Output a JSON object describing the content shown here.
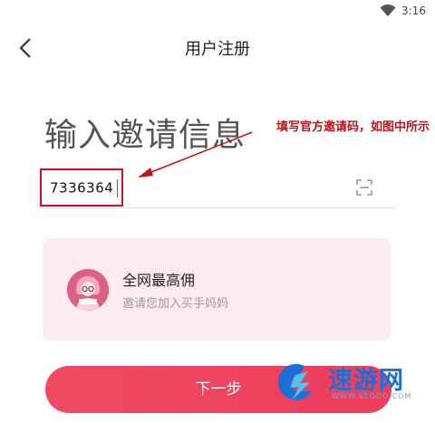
{
  "status_bar": {
    "time": "3:16",
    "wifi_icon": "wifi-icon"
  },
  "header": {
    "title": "用户注册",
    "back_icon": "chevron-left-icon"
  },
  "form": {
    "heading": "输入邀请信息",
    "code_value": "7336364",
    "scan_icon": "scan-icon"
  },
  "annotation": {
    "text": "填写官方邀请码，如图中所示",
    "color": "#c0101a"
  },
  "promo": {
    "title": "全网最高佣",
    "subtitle": "邀请您加入买手妈妈",
    "background": "#fdecef"
  },
  "next_button": {
    "label": "下一步",
    "color": "#ee3d5c"
  },
  "watermark": {
    "name": "速游网",
    "url": "WWW.SEOOO.COM"
  }
}
